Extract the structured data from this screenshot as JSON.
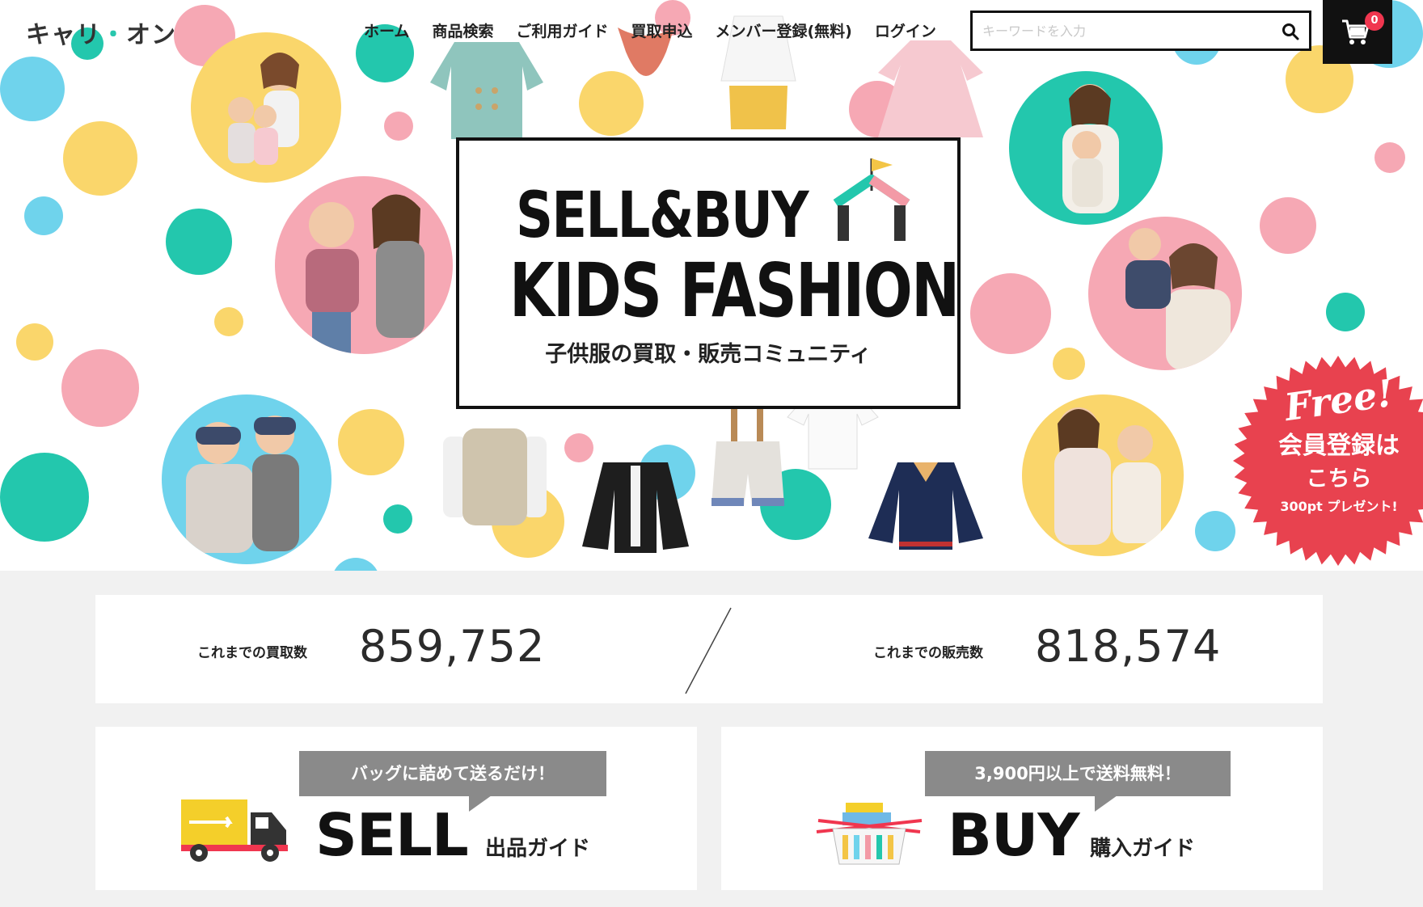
{
  "header": {
    "logo": {
      "pre": "キャリ",
      "dot": "・",
      "post": "オン"
    },
    "nav": [
      "ホーム",
      "商品検索",
      "ご利用ガイド",
      "買取申込",
      "メンバー登録(無料)",
      "ログイン"
    ],
    "search": {
      "placeholder": "キーワードを入力",
      "icon": "search-icon"
    },
    "cart": {
      "icon": "cart-icon",
      "count": "0"
    }
  },
  "hero": {
    "line1": "SELL&BUY",
    "line2": "KIDS FASHION",
    "subtitle": "子供服の買取・販売コミュニティ",
    "badge": {
      "free": "Free!",
      "line1": "会員登録は",
      "line2": "こちら",
      "line3": "300pt プレゼント!"
    }
  },
  "stats": {
    "bought_label": "これまでの買取数",
    "bought_value": "859,752",
    "sold_label": "これまでの販売数",
    "sold_value": "818,574"
  },
  "sell_card": {
    "bubble": "バッグに詰めて送るだけ！",
    "title": "SELL",
    "subtitle": "出品ガイド",
    "icon": "truck-icon"
  },
  "buy_card": {
    "bubble": "3,900円以上で送料無料！",
    "title": "BUY",
    "subtitle": "購入ガイド",
    "icon": "basket-icon"
  },
  "colors": {
    "teal": "#23c7ad",
    "yellow": "#fad66b",
    "pink": "#f6a8b4",
    "sky": "#6fd3ec",
    "badge_red": "#e8424f",
    "cart_badge": "#f0364f"
  }
}
